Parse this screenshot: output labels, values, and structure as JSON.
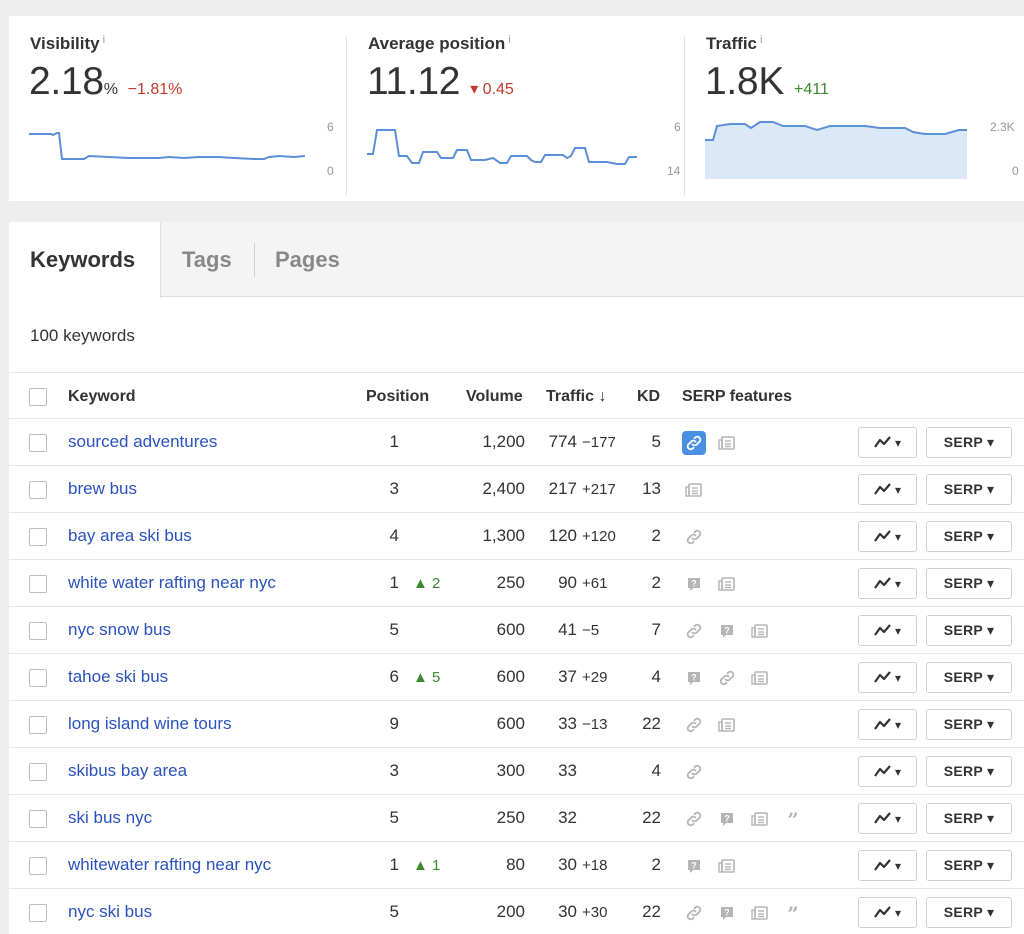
{
  "metrics": {
    "visibility": {
      "label": "Visibility",
      "info": "i",
      "value": "2.18",
      "unit": "%",
      "delta": "−1.81%",
      "axis_top": "6",
      "axis_bottom": "0"
    },
    "avg_position": {
      "label": "Average position",
      "info": "i",
      "value": "11.12",
      "delta": "▾ 0.45",
      "axis_top": "6",
      "axis_bottom": "14"
    },
    "traffic": {
      "label": "Traffic",
      "info": "i",
      "value": "1.8K",
      "delta": "+411",
      "axis_top": "2.3K",
      "axis_bottom": "0"
    }
  },
  "tabs": [
    "Keywords",
    "Tags",
    "Pages"
  ],
  "keyword_count": "100 keywords",
  "columns": {
    "keyword": "Keyword",
    "position": "Position",
    "volume": "Volume",
    "traffic": "Traffic ↓",
    "kd": "KD",
    "serp_features": "SERP features"
  },
  "buttons": {
    "trend": "▾",
    "serp": "SERP ▾"
  },
  "colors": {
    "link": "#2a52be",
    "negative": "#c0392b",
    "positive": "#3c8a2e",
    "accent": "#4a90e2"
  },
  "rows": [
    {
      "keyword": "sourced adventures",
      "position": "1",
      "position_change": "",
      "volume": "1,200",
      "traffic": "774",
      "traffic_change": "−177",
      "traffic_change_dir": "neg",
      "kd": "5",
      "serp": [
        "link-hl",
        "news"
      ]
    },
    {
      "keyword": "brew bus",
      "position": "3",
      "position_change": "",
      "volume": "2,400",
      "traffic": "217",
      "traffic_change": "+217",
      "traffic_change_dir": "pos",
      "kd": "13",
      "serp": [
        "news"
      ]
    },
    {
      "keyword": "bay area ski bus",
      "position": "4",
      "position_change": "",
      "volume": "1,300",
      "traffic": "120",
      "traffic_change": "+120",
      "traffic_change_dir": "pos",
      "kd": "2",
      "serp": [
        "link"
      ]
    },
    {
      "keyword": "white water rafting near nyc",
      "position": "1",
      "position_change": "▲ 2",
      "volume": "250",
      "traffic": "90",
      "traffic_change": "+61",
      "traffic_change_dir": "pos",
      "kd": "2",
      "serp": [
        "question",
        "news"
      ]
    },
    {
      "keyword": "nyc snow bus",
      "position": "5",
      "position_change": "",
      "volume": "600",
      "traffic": "41",
      "traffic_change": "−5",
      "traffic_change_dir": "neg",
      "kd": "7",
      "serp": [
        "link",
        "question",
        "news"
      ]
    },
    {
      "keyword": "tahoe ski bus",
      "position": "6",
      "position_change": "▲ 5",
      "volume": "600",
      "traffic": "37",
      "traffic_change": "+29",
      "traffic_change_dir": "pos",
      "kd": "4",
      "serp": [
        "question",
        "link",
        "news"
      ]
    },
    {
      "keyword": "long island wine tours",
      "position": "9",
      "position_change": "",
      "volume": "600",
      "traffic": "33",
      "traffic_change": "−13",
      "traffic_change_dir": "neg",
      "kd": "22",
      "serp": [
        "link",
        "news"
      ]
    },
    {
      "keyword": "skibus bay area",
      "position": "3",
      "position_change": "",
      "volume": "300",
      "traffic": "33",
      "traffic_change": "",
      "traffic_change_dir": "",
      "kd": "4",
      "serp": [
        "link"
      ]
    },
    {
      "keyword": "ski bus nyc",
      "position": "5",
      "position_change": "",
      "volume": "250",
      "traffic": "32",
      "traffic_change": "",
      "traffic_change_dir": "",
      "kd": "22",
      "serp": [
        "link",
        "question",
        "news",
        "quote"
      ]
    },
    {
      "keyword": "whitewater rafting near nyc",
      "position": "1",
      "position_change": "▲ 1",
      "volume": "80",
      "traffic": "30",
      "traffic_change": "+18",
      "traffic_change_dir": "pos",
      "kd": "2",
      "serp": [
        "question",
        "news"
      ]
    },
    {
      "keyword": "nyc ski bus",
      "position": "5",
      "position_change": "",
      "volume": "200",
      "traffic": "30",
      "traffic_change": "+30",
      "traffic_change_dir": "pos",
      "kd": "22",
      "serp": [
        "link",
        "question",
        "news",
        "quote"
      ]
    }
  ]
}
